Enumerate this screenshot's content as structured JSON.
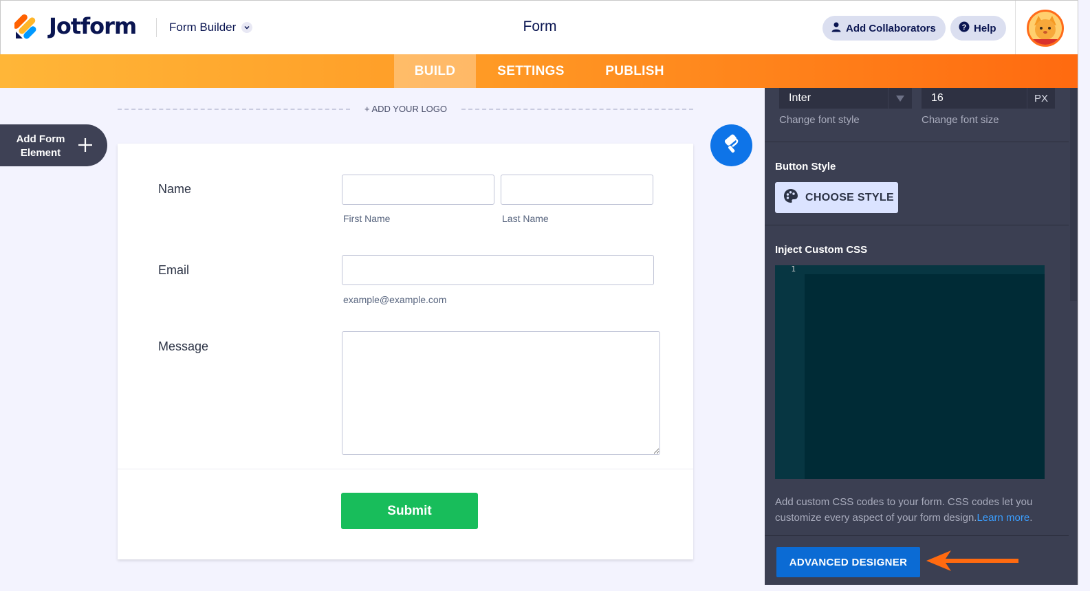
{
  "header": {
    "brand": "Jotform",
    "builder_label": "Form Builder",
    "title": "Form",
    "add_collaborators": "Add Collaborators",
    "help": "Help"
  },
  "nav": {
    "tabs": [
      {
        "label": "BUILD",
        "active": true
      },
      {
        "label": "SETTINGS",
        "active": false
      },
      {
        "label": "PUBLISH",
        "active": false
      }
    ]
  },
  "canvas": {
    "add_logo": "+ ADD YOUR LOGO",
    "add_element_label": "Add Form Element",
    "add_element_line1": "Add Form",
    "add_element_line2": "Element"
  },
  "form": {
    "name_label": "Name",
    "first_name_sub": "First Name",
    "last_name_sub": "Last Name",
    "first_name_value": "",
    "last_name_value": "",
    "email_label": "Email",
    "email_value": "",
    "email_sub": "example@example.com",
    "message_label": "Message",
    "message_value": "",
    "submit_label": "Submit"
  },
  "panel": {
    "font_style_value": "Inter",
    "font_style_caption": "Change font style",
    "font_size_value": "16",
    "font_size_unit": "PX",
    "font_size_caption": "Change font size",
    "button_style_heading": "Button Style",
    "choose_style_label": "CHOOSE STYLE",
    "inject_css_heading": "Inject Custom CSS",
    "code_line_number": "1",
    "description": "Add custom CSS codes to your form. CSS codes let you customize every aspect of your form design.",
    "learn_more": "Learn more",
    "description_end": ".",
    "advanced_designer_label": "ADVANCED DESIGNER"
  },
  "colors": {
    "brand_navy": "#0a1551",
    "nav_orange": "#ff6a10",
    "submit_green": "#18bd5b",
    "panel_bg": "#3b3f52",
    "accent_blue": "#0b6bd4",
    "annotation_arrow": "#ff6a10"
  },
  "icons": {
    "logo": "jotform-logo-icon",
    "builder_dropdown": "chevron-down-icon",
    "collaborators": "user-icon",
    "help": "question-circle-icon",
    "designer": "paint-roller-icon",
    "add": "plus-icon",
    "palette": "palette-icon",
    "font_dropdown": "caret-down-icon"
  }
}
